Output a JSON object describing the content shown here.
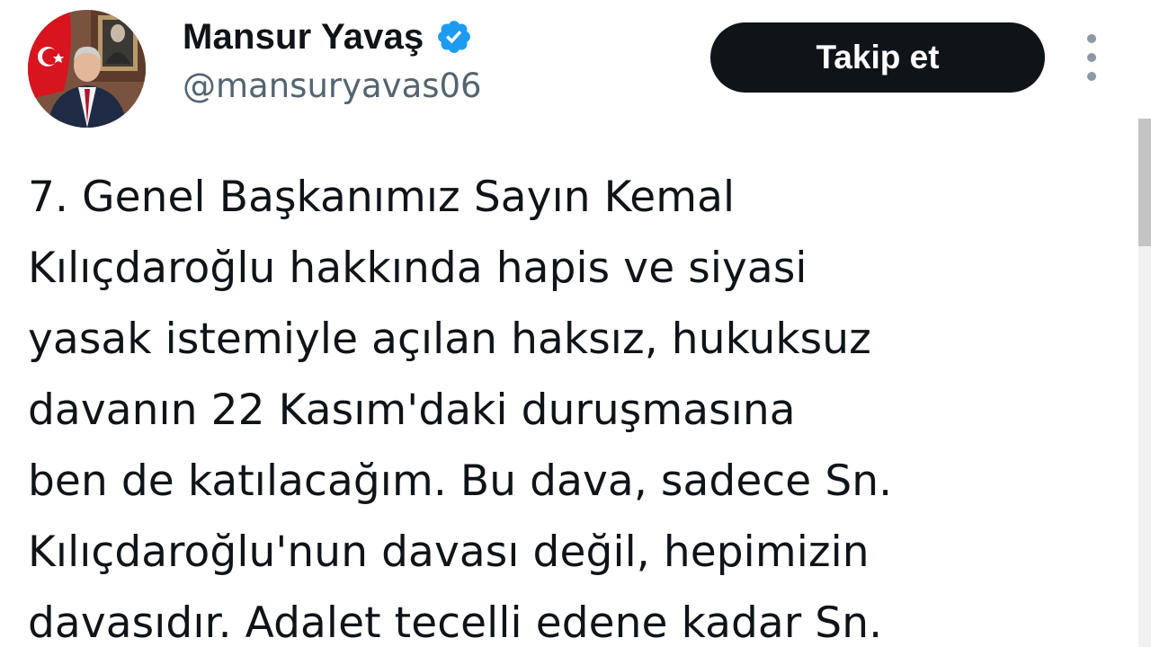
{
  "author": {
    "display_name": "Mansur Yavaş",
    "handle": "@mansuryavas06",
    "verified_color": "#1d9bf0"
  },
  "follow_button": {
    "label": "Takip et"
  },
  "more_menu": {
    "icon": "more-vertical-icon"
  },
  "tweet": {
    "lines": [
      "7. Genel Başkanımız Sayın Kemal",
      "Kılıçdaroğlu hakkında hapis ve siyasi",
      "yasak istemiyle açılan haksız, hukuksuz",
      "davanın 22 Kasım'daki duruşmasına",
      "ben de katılacağım. Bu dava, sadece Sn.",
      "Kılıçdaroğlu'nun davası değil, hepimizin",
      "davasıdır. Adalet tecelli edene kadar Sn."
    ]
  },
  "colors": {
    "text_primary": "#0f1419",
    "text_secondary": "#536471",
    "button_bg": "#0f1419",
    "button_text": "#ffffff"
  }
}
